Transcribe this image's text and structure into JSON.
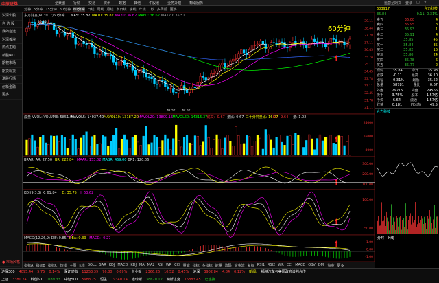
{
  "app": {
    "logo": "中原证券",
    "menus": [
      "全景图",
      "行情",
      "交易",
      "资讯",
      "数据",
      "其他",
      "牛股池",
      "业务办理",
      "帮助服务"
    ],
    "window_right": [
      "运营至期货",
      "登录",
      "□",
      "×"
    ]
  },
  "toolbar": {
    "items": [
      "1分钟",
      "5分钟",
      "15分钟",
      "30分钟",
      "60分钟",
      "日线",
      "周线",
      "月线",
      "多日线",
      "季线",
      "年线",
      "1秒",
      "多周期",
      "更多"
    ],
    "active_index": 4,
    "right_items": [
      "画线",
      "F10",
      "加自",
      "返回"
    ]
  },
  "sidebar": {
    "items": [
      {
        "label": "沪深个股",
        "red": false
      },
      {
        "label": "自 选 股",
        "red": false
      },
      {
        "label": "我的自选",
        "red": false
      },
      {
        "label": "沪深板块",
        "red": false
      },
      {
        "label": "热点主题",
        "red": false
      },
      {
        "label": "新股IPO",
        "red": false
      },
      {
        "label": "期权市场",
        "red": false
      },
      {
        "label": "期货现货",
        "red": false
      },
      {
        "label": "港股行情",
        "red": false
      },
      {
        "label": "创新金融",
        "red": false
      },
      {
        "label": "更多",
        "red": false
      }
    ],
    "bottom": {
      "label": "● 市场风格",
      "red": true
    }
  },
  "chart": {
    "main_label": "东方财富(603917)60分钟",
    "ma_legend": [
      {
        "t": "MA5: 35.82",
        "c": "#fff"
      },
      {
        "t": "MA10: 35.82",
        "c": "#ff0"
      },
      {
        "t": "MA20: 36.62",
        "c": "#f0f"
      },
      {
        "t": "MA60: 36.62",
        "c": "#0f0"
      },
      {
        "t": "MA120: 35.51",
        "c": "#aaa"
      }
    ],
    "period_label": "60分钟",
    "high_label": "40.35",
    "low_label": "30.52",
    "low_label2": "30.52",
    "vol_legend": [
      {
        "t": "成量 VVOL: VOLUME: 5851.00",
        "c": "#ddd"
      },
      {
        "t": "MAVOL5: 14037.40",
        "c": "#fff"
      },
      {
        "t": "MAVOL10: 13187.20",
        "c": "#ff0"
      },
      {
        "t": "MAVOL20: 13809.15",
        "c": "#f0f"
      },
      {
        "t": "MAVOL60: 14315.37",
        "c": "#0f0"
      },
      {
        "t": "成交: -0.67",
        "c": "#f33"
      },
      {
        "t": "量比: 0.67",
        "c": "#ddd"
      },
      {
        "t": "三十分钟量比: 16.27",
        "c": "#ff0"
      },
      {
        "t": "K1: -9.64",
        "c": "#f33"
      },
      {
        "t": "量: 1.02",
        "c": "#ddd"
      }
    ],
    "brar_legend": [
      {
        "t": "BRAR: AR: 27.50",
        "c": "#ddd"
      },
      {
        "t": "BR: 222.84",
        "c": "#ff0"
      },
      {
        "t": "MAAR: 153.02",
        "c": "#f0f"
      },
      {
        "t": "MABR: 469.00",
        "c": "#0ff"
      },
      {
        "t": "BR1: 120.06",
        "c": "#ddd"
      }
    ],
    "kdj_legend": [
      {
        "t": "KDJ(9,3,3) K: 61.84",
        "c": "#ddd"
      },
      {
        "t": "D: 35.75",
        "c": "#ff0"
      },
      {
        "t": "J: 63.62",
        "c": "#f0f"
      }
    ],
    "macd_legend": [
      {
        "t": "MACD(12,26,9) DIF: 0.85",
        "c": "#ddd"
      },
      {
        "t": "DEA: 0.39",
        "c": "#ff0"
      },
      {
        "t": "MACD: -0.27",
        "c": "#f0f"
      }
    ],
    "price_axis": [
      "39.11",
      "38.44",
      "37.78",
      "37.11",
      "36.45",
      "35.78",
      "35.11",
      "34.45",
      "33.78",
      "33.11",
      "32.45",
      "31.78",
      "31.11"
    ],
    "vol_axis": [
      "24000",
      "16000",
      "8000"
    ],
    "brar_axis": [
      "300.00",
      "200.00",
      "100.00"
    ],
    "kdj_axis": [
      "100.00",
      "50.00"
    ],
    "macd_axis": [
      "1.00",
      "0.00",
      "-1.00"
    ]
  },
  "quote": {
    "code": "603917",
    "name": "合力科技",
    "price": "35.84",
    "change_line": "-0.11 -0.31%",
    "sells": [
      {
        "k": "卖五",
        "p": "36.00",
        "v": "4"
      },
      {
        "k": "卖四",
        "p": "35.95",
        "v": "3"
      },
      {
        "k": "卖三",
        "p": "35.93",
        "v": "1"
      },
      {
        "k": "卖二",
        "p": "35.91",
        "v": "4"
      },
      {
        "k": "卖一",
        "p": "35.85",
        "v": "45"
      }
    ],
    "buys": [
      {
        "k": "买一",
        "p": "35.84",
        "v": "35"
      },
      {
        "k": "买二",
        "p": "35.82",
        "v": "16"
      },
      {
        "k": "买三",
        "p": "35.80",
        "v": "24"
      },
      {
        "k": "买四",
        "p": "35.78",
        "v": "6"
      },
      {
        "k": "买五",
        "p": "35.77",
        "v": "2"
      }
    ],
    "stats": [
      {
        "k": "现价",
        "v": "35.84",
        "k2": "今开",
        "v2": "35.98"
      },
      {
        "k": "涨跌",
        "v": "-0.11",
        "k2": "最高",
        "v2": "36.10"
      },
      {
        "k": "涨幅",
        "v": "-0.31%",
        "k2": "最低",
        "v2": "35.52"
      },
      {
        "k": "总量",
        "v": "58781",
        "k2": "量比",
        "v2": "0.67"
      },
      {
        "k": "外盘",
        "v": "29215",
        "k2": "内盘",
        "v2": "29566"
      },
      {
        "k": "换手",
        "v": "3.75%",
        "k2": "股本",
        "v2": "1.57亿"
      },
      {
        "k": "净资",
        "v": "6.64",
        "k2": "流通",
        "v2": "1.57亿"
      },
      {
        "k": "收益",
        "v": "0.181",
        "k2": "PE(动)",
        "v2": "49.5"
      }
    ],
    "trade_title": "合力科技",
    "tabs": [
      "分时",
      "K线"
    ]
  },
  "bottom_tabs": [
    "指标A",
    "指标B",
    "指标C",
    "均线",
    "主图",
    "K线",
    "BOLL",
    "SAR",
    "KDJ",
    "MACD",
    "KDJ",
    "MA",
    "MA2",
    "RSI",
    "WR",
    "CCI",
    "量能",
    "指标",
    "多指标",
    "能量",
    "筹码",
    "资金流",
    "复权",
    "RSI1",
    "RSI2",
    "WR",
    "CCI",
    "MACD",
    "OBV",
    "DMI",
    "资金",
    "更多"
  ],
  "status": {
    "row1": [
      {
        "t": "沪深300",
        "c": "wht"
      },
      {
        "t": "4095.44",
        "c": "up"
      },
      {
        "t": "5.75",
        "c": "up"
      },
      {
        "t": "0.14%",
        "c": "up"
      },
      {
        "t": "深证成指",
        "c": "wht"
      },
      {
        "t": "11253.39",
        "c": "up"
      },
      {
        "t": "76.80",
        "c": "up"
      },
      {
        "t": "0.69%",
        "c": "up"
      },
      {
        "t": "创业板",
        "c": "wht"
      },
      {
        "t": "2366.26",
        "c": "up"
      },
      {
        "t": "10.52",
        "c": "up"
      },
      {
        "t": "0.45%",
        "c": "up"
      },
      {
        "t": "沪深",
        "c": "wht"
      },
      {
        "t": "3902.84",
        "c": "up"
      },
      {
        "t": "4.84",
        "c": "up"
      },
      {
        "t": "0.12%",
        "c": "up"
      },
      {
        "t": "新闻:",
        "c": "yel"
      },
      {
        "t": "福特汽车与美国政府谈判合作",
        "c": "wht"
      }
    ],
    "row2": [
      {
        "t": "上证",
        "c": "wht"
      },
      {
        "t": "3380.24",
        "c": "up"
      },
      {
        "t": "科创50",
        "c": "wht"
      },
      {
        "t": "1089.33",
        "c": "down"
      },
      {
        "t": "中证500",
        "c": "wht"
      },
      {
        "t": "5988.25",
        "c": "up"
      },
      {
        "t": "恒生",
        "c": "wht"
      },
      {
        "t": "19340.14",
        "c": "up"
      },
      {
        "t": "道琼斯",
        "c": "wht"
      },
      {
        "t": "38620.12",
        "c": "down"
      },
      {
        "t": "纳斯达克",
        "c": "wht"
      },
      {
        "t": "15883.45",
        "c": "up"
      },
      {
        "t": "已连接",
        "c": "grn"
      }
    ]
  }
}
